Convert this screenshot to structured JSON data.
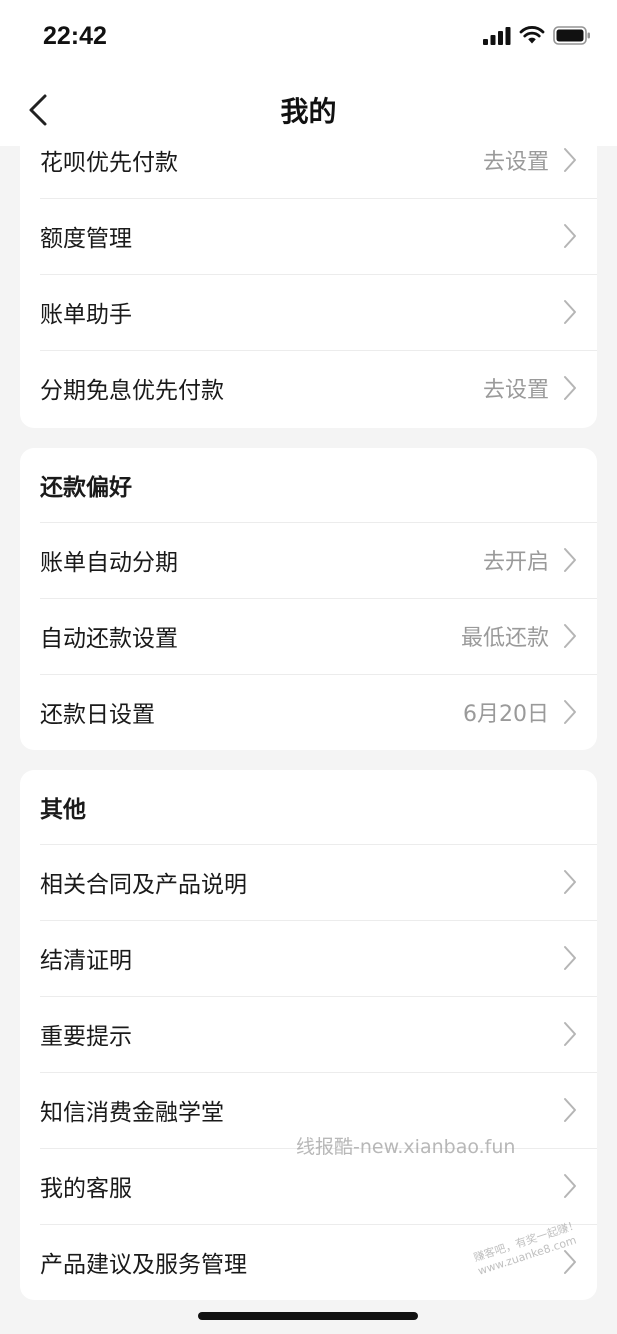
{
  "status": {
    "time": "22:42"
  },
  "nav": {
    "title": "我的"
  },
  "section1": {
    "rows": [
      {
        "label": "花呗优先付款",
        "value": "去设置"
      },
      {
        "label": "额度管理",
        "value": ""
      },
      {
        "label": "账单助手",
        "value": ""
      },
      {
        "label": "分期免息优先付款",
        "value": "去设置"
      }
    ]
  },
  "section2": {
    "title": "还款偏好",
    "rows": [
      {
        "label": "账单自动分期",
        "value": "去开启"
      },
      {
        "label": "自动还款设置",
        "value": "最低还款"
      },
      {
        "label": "还款日设置",
        "value": "6月20日"
      }
    ]
  },
  "section3": {
    "title": "其他",
    "rows": [
      {
        "label": "相关合同及产品说明",
        "value": ""
      },
      {
        "label": "结清证明",
        "value": ""
      },
      {
        "label": "重要提示",
        "value": ""
      },
      {
        "label": "知信消费金融学堂",
        "value": ""
      },
      {
        "label": "我的客服",
        "value": ""
      },
      {
        "label": "产品建议及服务管理",
        "value": ""
      }
    ]
  },
  "watermark": {
    "main": "线报酷-new.xianbao.fun",
    "corner_line1": "赚客吧，有奖一起赚！",
    "corner_line2": "www.zuanke8.com"
  },
  "colors": {
    "background": "#f4f4f4",
    "card": "#ffffff",
    "secondary_text": "#9a9a9a"
  },
  "icons": [
    "signal-icon",
    "wifi-icon",
    "battery-icon",
    "back-arrow-icon",
    "chevron-right-icon"
  ]
}
